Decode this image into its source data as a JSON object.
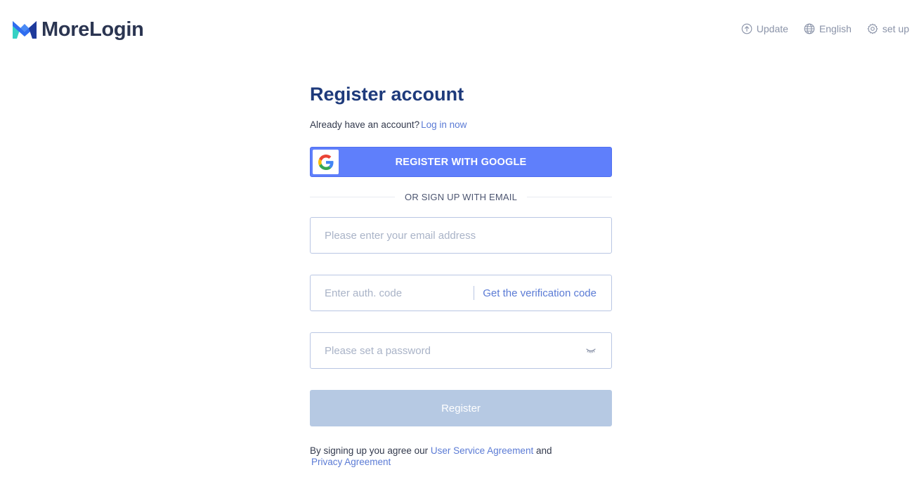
{
  "header": {
    "logo_text": "MoreLogin",
    "actions": {
      "update": "Update",
      "language": "English",
      "setup": "set up"
    }
  },
  "form": {
    "title": "Register account",
    "login_prompt": "Already have an account?",
    "login_link": "Log in now",
    "google_button": "REGISTER WITH GOOGLE",
    "divider_text": "OR SIGN UP WITH EMAIL",
    "email": {
      "placeholder": "Please enter your email address",
      "value": ""
    },
    "auth_code": {
      "placeholder": "Enter auth. code",
      "value": ""
    },
    "get_code_link": "Get the verification code",
    "password": {
      "placeholder": "Please set a password",
      "value": ""
    },
    "register_button": "Register",
    "agreement": {
      "prefix": "By signing up you agree our",
      "user_agreement": "User Service Agreement",
      "and": "and",
      "privacy_agreement": "Privacy Agreement"
    }
  },
  "colors": {
    "brand_navy": "#1e3a7b",
    "google_button": "#5f7ffb",
    "link": "#5b7bd5",
    "register_disabled": "#b6c9e3",
    "input_border": "#b9c6e3"
  },
  "icons": {
    "update": "upload-circle-icon",
    "language": "globe-icon",
    "setup": "gear-icon",
    "google": "google-logo-icon",
    "password_visibility": "eye-closed-icon"
  }
}
